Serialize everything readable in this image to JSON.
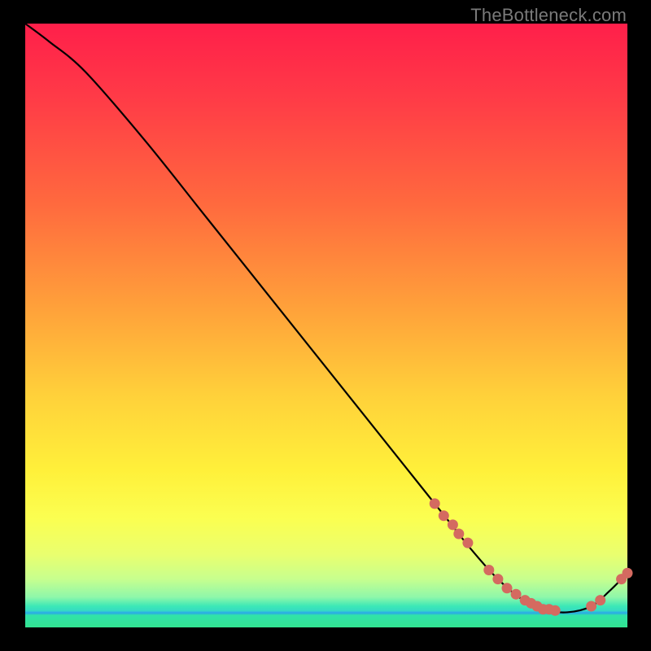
{
  "watermark": "TheBottleneck.com",
  "chart_data": {
    "type": "line",
    "title": "",
    "xlabel": "",
    "ylabel": "",
    "xlim": [
      0,
      100
    ],
    "ylim": [
      0,
      100
    ],
    "grid": false,
    "legend": false,
    "series": [
      {
        "name": "curve",
        "style": "line",
        "color": "#000000",
        "x": [
          0,
          4,
          10,
          20,
          30,
          40,
          50,
          60,
          70,
          74,
          78,
          82,
          86,
          90,
          94,
          97,
          100
        ],
        "y": [
          100,
          97,
          92,
          80.5,
          68,
          55.5,
          43,
          30.5,
          18,
          13,
          8.5,
          5,
          3,
          2.5,
          3.5,
          6,
          9
        ]
      },
      {
        "name": "points-on-curve",
        "style": "scatter",
        "color": "#d46a60",
        "x": [
          68,
          69.5,
          71,
          72,
          73.5,
          77,
          78.5,
          80,
          81.5,
          83,
          84,
          85,
          86,
          87,
          88,
          94,
          95.5,
          99,
          100
        ],
        "y": [
          20.5,
          18.5,
          17,
          15.5,
          14,
          9.5,
          8,
          6.5,
          5.5,
          4.5,
          4,
          3.5,
          3,
          3,
          2.8,
          3.5,
          4.5,
          8,
          9
        ]
      }
    ]
  }
}
